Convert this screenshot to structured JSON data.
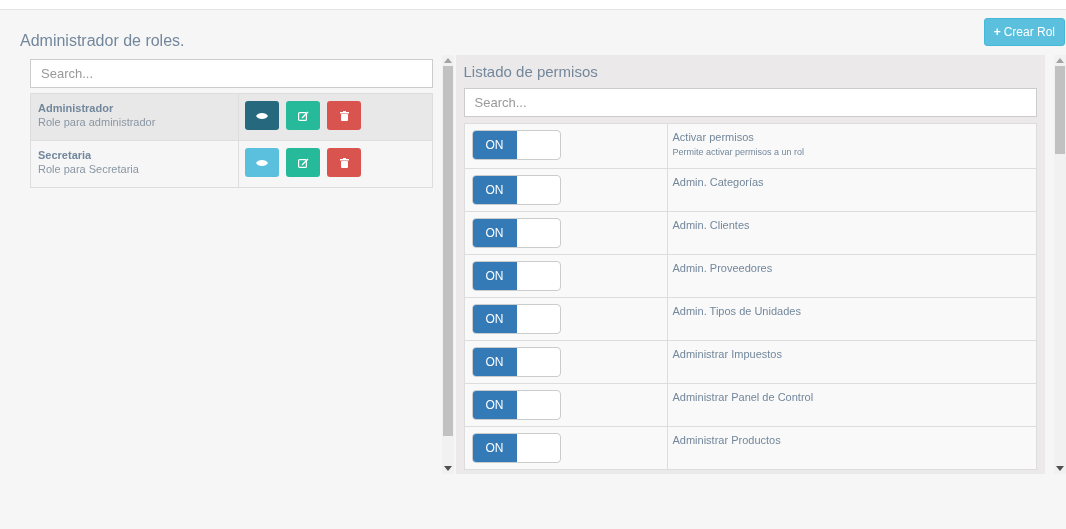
{
  "page_title": "Administrador de roles.",
  "create_button": {
    "icon": "+",
    "label": "Crear Rol"
  },
  "roles": {
    "search": {
      "placeholder": "Search..."
    },
    "rows": [
      {
        "name": "Administrador",
        "description": "Role para administrador",
        "selected": true
      },
      {
        "name": "Secretaria",
        "description": "Role para Secretaria",
        "selected": false
      }
    ]
  },
  "permissions": {
    "title": "Listado de permisos",
    "search": {
      "placeholder": "Search..."
    },
    "rows": [
      {
        "toggle": "ON",
        "on": true,
        "name": "Activar permisos",
        "description": "Permite activar permisos a un rol"
      },
      {
        "toggle": "ON",
        "on": true,
        "name": "Admin. Categorías"
      },
      {
        "toggle": "ON",
        "on": true,
        "name": "Admin. Clientes"
      },
      {
        "toggle": "ON",
        "on": true,
        "name": "Admin. Proveedores"
      },
      {
        "toggle": "ON",
        "on": true,
        "name": "Admin. Tipos de Unidades"
      },
      {
        "toggle": "ON",
        "on": true,
        "name": "Administrar Impuestos"
      },
      {
        "toggle": "ON",
        "on": true,
        "name": "Administrar Panel de Control"
      },
      {
        "toggle": "ON",
        "on": true,
        "name": "Administrar Productos"
      }
    ]
  }
}
